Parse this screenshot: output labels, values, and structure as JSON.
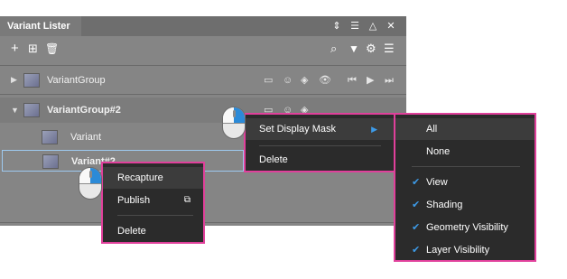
{
  "panel": {
    "title": "Variant Lister",
    "window_controls": [
      "⇕",
      "☰",
      "△",
      "✕"
    ]
  },
  "toolbar": {
    "left_icons": [
      "+",
      "⊞",
      "🗑"
    ],
    "right_icons": [
      "⌕",
      "▼",
      "⚙",
      "☰"
    ]
  },
  "rows": [
    {
      "label": "VariantGroup",
      "level": 0
    },
    {
      "label": "VariantGroup#2",
      "level": 0
    },
    {
      "label": "Variant",
      "level": 1
    },
    {
      "label": "Variant#2",
      "level": 1
    }
  ],
  "row_icons": [
    "▭",
    "☺",
    "◈",
    "👁",
    "⏮",
    "▶",
    "⏭"
  ],
  "context_menu": {
    "items": [
      "Recapture",
      "Publish",
      "Delete"
    ]
  },
  "group_menu": {
    "items": [
      "Set Display Mask",
      "Delete"
    ]
  },
  "mask_menu": {
    "items": [
      "All",
      "None",
      "View",
      "Shading",
      "Geometry Visibility",
      "Layer Visibility"
    ],
    "checked": [
      "View",
      "Shading",
      "Geometry Visibility",
      "Layer Visibility"
    ]
  },
  "colors": {
    "accent": "#e0409b",
    "check": "#3d9be8",
    "menu_bg": "#2b2b2b",
    "panel_bg": "#858585"
  }
}
